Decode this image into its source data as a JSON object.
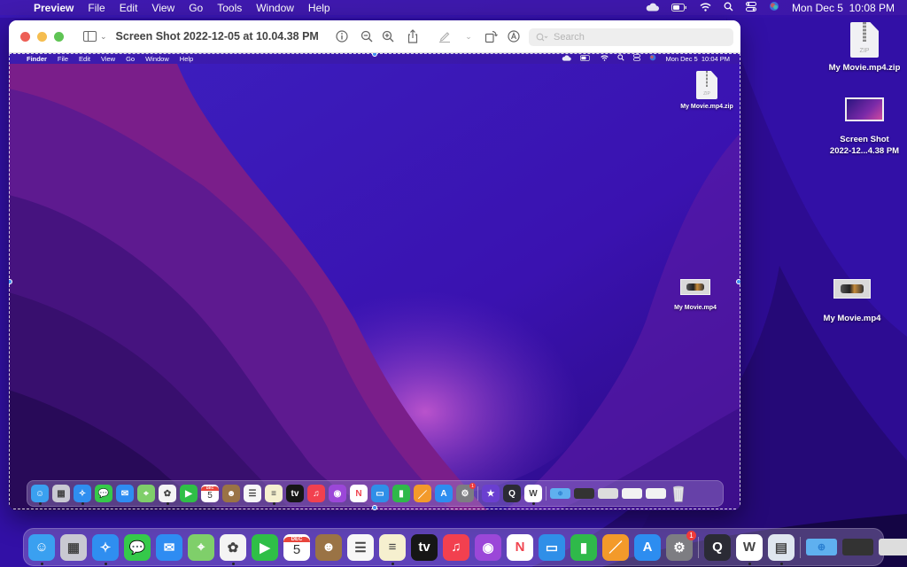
{
  "menubar": {
    "app_name": "Preview",
    "items": [
      "File",
      "Edit",
      "View",
      "Go",
      "Tools",
      "Window",
      "Help"
    ],
    "status_icons": [
      "icloud-icon",
      "battery-icon",
      "wifi-icon",
      "spotlight-search-icon",
      "control-center-icon",
      "siri-icon"
    ],
    "clock": "Mon Dec 5  10:08 PM"
  },
  "window": {
    "title": "Screen Shot 2022-12-05 at 10.04.38 PM",
    "toolbar": [
      "info-icon",
      "zoom-out-icon",
      "zoom-in-icon",
      "share-icon",
      "markup-pen-icon",
      "markup-menu-chevron-icon",
      "rotate-icon",
      "annotate-icon"
    ],
    "search_placeholder": "Search",
    "screenshot": {
      "menubar": {
        "app_name": "Finder",
        "items": [
          "File",
          "Edit",
          "View",
          "Go",
          "Window",
          "Help"
        ],
        "clock": "Mon Dec 5  10:04 PM"
      },
      "desktop_icons": [
        {
          "label": "My Movie.mp4.zip",
          "type": "zip"
        },
        {
          "label": "My Movie.mp4",
          "type": "movie"
        }
      ]
    }
  },
  "desktop_icons": [
    {
      "label": "My Movie.mp4.zip",
      "type": "zip"
    },
    {
      "label_line1": "Screen Shot",
      "label_line2": "2022-12...4.38 PM",
      "type": "screenshot"
    },
    {
      "label": "My Movie.mp4",
      "type": "movie"
    }
  ],
  "calendar": {
    "month": "DEC",
    "day": "5"
  },
  "dock": {
    "apps": [
      {
        "name": "Finder",
        "color": "#3aa0f0",
        "glyph": "☺",
        "running": true
      },
      {
        "name": "Launchpad",
        "color": "#c9c9d2",
        "glyph": "▦",
        "running": false
      },
      {
        "name": "Safari",
        "color": "#2f8ef0",
        "glyph": "✧",
        "running": true
      },
      {
        "name": "Messages",
        "color": "#35c94a",
        "glyph": "💬",
        "running": false
      },
      {
        "name": "Mail",
        "color": "#2e8cf2",
        "glyph": "✉",
        "running": false
      },
      {
        "name": "Maps",
        "color": "#7fcf6a",
        "glyph": "⌖",
        "running": false
      },
      {
        "name": "Photos",
        "color": "#f4f4f4",
        "glyph": "✿",
        "running": true
      },
      {
        "name": "FaceTime",
        "color": "#2fbf47",
        "glyph": "▶",
        "running": false
      },
      {
        "name": "Calendar",
        "color": "#ffffff",
        "glyph": "5",
        "running": false
      },
      {
        "name": "Contacts",
        "color": "#9a7345",
        "glyph": "☻",
        "running": false
      },
      {
        "name": "Reminders",
        "color": "#f7f7f7",
        "glyph": "☰",
        "running": false
      },
      {
        "name": "Notes",
        "color": "#f6f0cf",
        "glyph": "≡",
        "running": true
      },
      {
        "name": "TV",
        "color": "#161616",
        "glyph": "tv",
        "running": false
      },
      {
        "name": "Music",
        "color": "#f2404f",
        "glyph": "♫",
        "running": false
      },
      {
        "name": "Podcasts",
        "color": "#9b47d8",
        "glyph": "◉",
        "running": false
      },
      {
        "name": "News",
        "color": "#ffffff",
        "glyph": "N",
        "running": false
      },
      {
        "name": "Keynote",
        "color": "#2f8fe8",
        "glyph": "▭",
        "running": false
      },
      {
        "name": "Numbers",
        "color": "#2fb94a",
        "glyph": "▮",
        "running": false
      },
      {
        "name": "Pages",
        "color": "#f39a2a",
        "glyph": "／",
        "running": false
      },
      {
        "name": "App Store",
        "color": "#2d8df0",
        "glyph": "A",
        "running": false
      },
      {
        "name": "System Preferences",
        "color": "#7d7d82",
        "glyph": "⚙",
        "running": false,
        "badge": "1"
      }
    ],
    "recent_apps_inner": [
      {
        "name": "iMovie",
        "color": "#6a3fd0",
        "glyph": "★",
        "running": false
      },
      {
        "name": "QuickTime Player",
        "color": "#2b2b35",
        "glyph": "Q",
        "running": false
      },
      {
        "name": "Microsoft Word",
        "color": "#ffffff",
        "glyph": "W",
        "running": true
      }
    ],
    "recent_apps_outer": [
      {
        "name": "QuickTime Player",
        "color": "#2b2b35",
        "glyph": "Q",
        "running": false
      },
      {
        "name": "Microsoft Word",
        "color": "#ffffff",
        "glyph": "W",
        "running": true
      },
      {
        "name": "Preview",
        "color": "#dfe6ef",
        "glyph": "▤",
        "running": true
      }
    ],
    "stacks": [
      {
        "name": "Downloads",
        "color": "#5fb0ef",
        "glyph": "⊕"
      },
      {
        "name": "Recent Safari window",
        "color": "#333"
      },
      {
        "name": "Recent Photos window",
        "color": "#ddd"
      },
      {
        "name": "Recent Word document",
        "color": "#f2f2f2"
      },
      {
        "name": "Recent document",
        "color": "#f2f2f2"
      }
    ],
    "trash": {
      "name": "Trash",
      "glyph": "🗑"
    }
  }
}
